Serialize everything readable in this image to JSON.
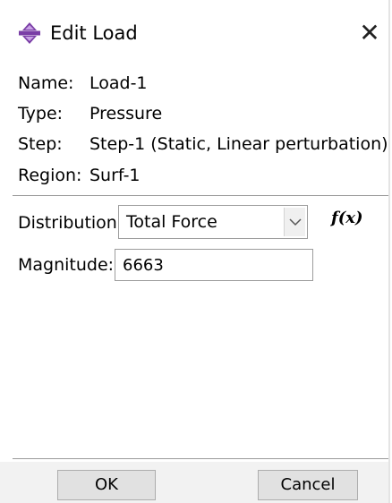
{
  "window": {
    "title": "Edit Load",
    "title_icon": "move-arrows-icon",
    "close_glyph": "✕"
  },
  "info": {
    "name_label": "Name:",
    "name_value": "Load-1",
    "type_label": "Type:",
    "type_value": "Pressure",
    "step_label": "Step:",
    "step_value": "Step-1 (Static, Linear perturbation)",
    "region_label": "Region:",
    "region_value": "Surf-1"
  },
  "form": {
    "distribution_label": "Distribution:",
    "distribution_value": "Total Force",
    "fx_label": "f(x)",
    "magnitude_label": "Magnitude:",
    "magnitude_value": "6663"
  },
  "buttons": {
    "ok_label": "OK",
    "cancel_label": "Cancel"
  },
  "colors": {
    "icon_accent": "#7a3ea6",
    "divider": "#9a9a9a",
    "button_face": "#e1e1e1"
  }
}
